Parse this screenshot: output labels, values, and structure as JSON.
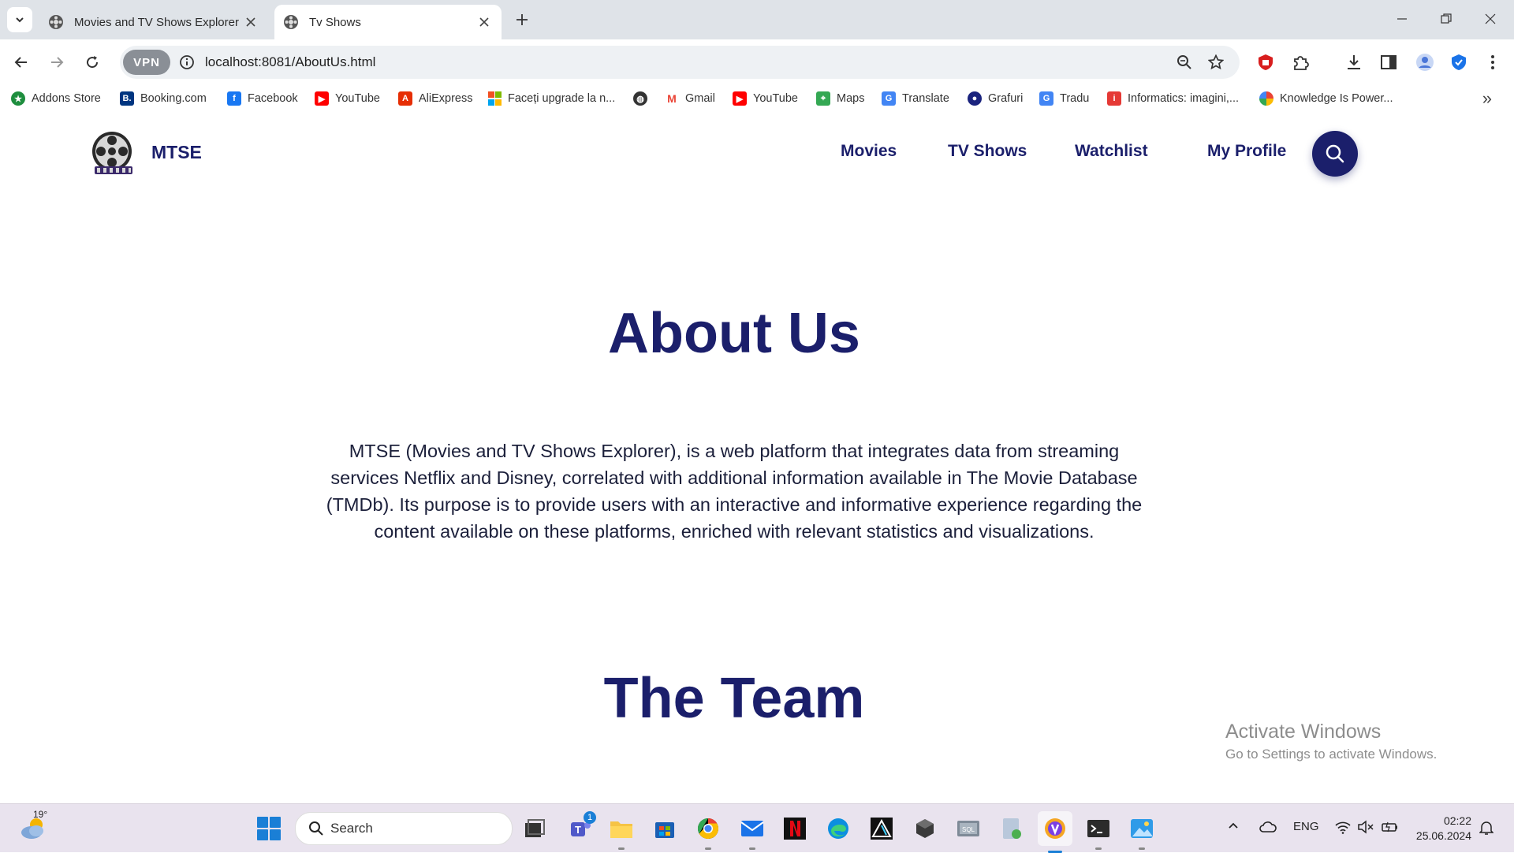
{
  "browser": {
    "tabs": [
      {
        "title": "Movies and TV Shows Explorer",
        "active": false,
        "icon": "film-reel-icon"
      },
      {
        "title": "Tv Shows",
        "active": true,
        "icon": "film-reel-icon"
      }
    ],
    "address": {
      "url": "localhost:8081/AboutUs.html",
      "vpn_label": "VPN"
    },
    "bookmarks": [
      {
        "label": "Addons Store",
        "icon": "addons-icon",
        "color": "#1e8e3e"
      },
      {
        "label": "Booking.com",
        "icon": "booking-icon",
        "color": "#003580"
      },
      {
        "label": "Facebook",
        "icon": "facebook-icon",
        "color": "#1877f2"
      },
      {
        "label": "YouTube",
        "icon": "youtube-icon",
        "color": "#ff0000"
      },
      {
        "label": "AliExpress",
        "icon": "aliexpress-icon",
        "color": "#e62e04"
      },
      {
        "label": "Faceți upgrade la n...",
        "icon": "windows-icon",
        "color": "#f25022"
      },
      {
        "label": "",
        "icon": "globe-icon",
        "color": "#333333"
      },
      {
        "label": "Gmail",
        "icon": "gmail-icon",
        "color": "#ea4335"
      },
      {
        "label": "YouTube",
        "icon": "youtube-icon",
        "color": "#ff0000"
      },
      {
        "label": "Maps",
        "icon": "maps-icon",
        "color": "#34a853"
      },
      {
        "label": "Translate",
        "icon": "translate-icon",
        "color": "#4285f4"
      },
      {
        "label": "Grafuri",
        "icon": "grafuri-icon",
        "color": "#1a237e"
      },
      {
        "label": "Tradu",
        "icon": "translate-icon",
        "color": "#4285f4"
      },
      {
        "label": "Informatics: imagini,...",
        "icon": "informatics-icon",
        "color": "#e53935"
      },
      {
        "label": "Knowledge Is Power...",
        "icon": "pinwheel-icon",
        "color": "#fbbc04"
      }
    ]
  },
  "site": {
    "brand": "MTSE",
    "nav": [
      "Movies",
      "TV Shows",
      "Watchlist",
      "My Profile"
    ],
    "heading_about": "About Us",
    "about_text": "MTSE (Movies and TV Shows Explorer), is a web platform that integrates data from streaming services Netflix and Disney, correlated with additional information available in The Movie Database (TMDb). Its purpose is to provide users with an interactive and informative experience regarding the content available on these platforms, enriched with relevant statistics and visualizations.",
    "heading_team": "The Team",
    "accent_color": "#1b1f6b"
  },
  "watermark": {
    "title": "Activate Windows",
    "subtitle": "Go to Settings to activate Windows."
  },
  "taskbar": {
    "weather_temp": "19°",
    "search_placeholder": "Search",
    "teams_badge": "1",
    "language": "ENG",
    "time": "02:22",
    "date": "25.06.2024"
  }
}
